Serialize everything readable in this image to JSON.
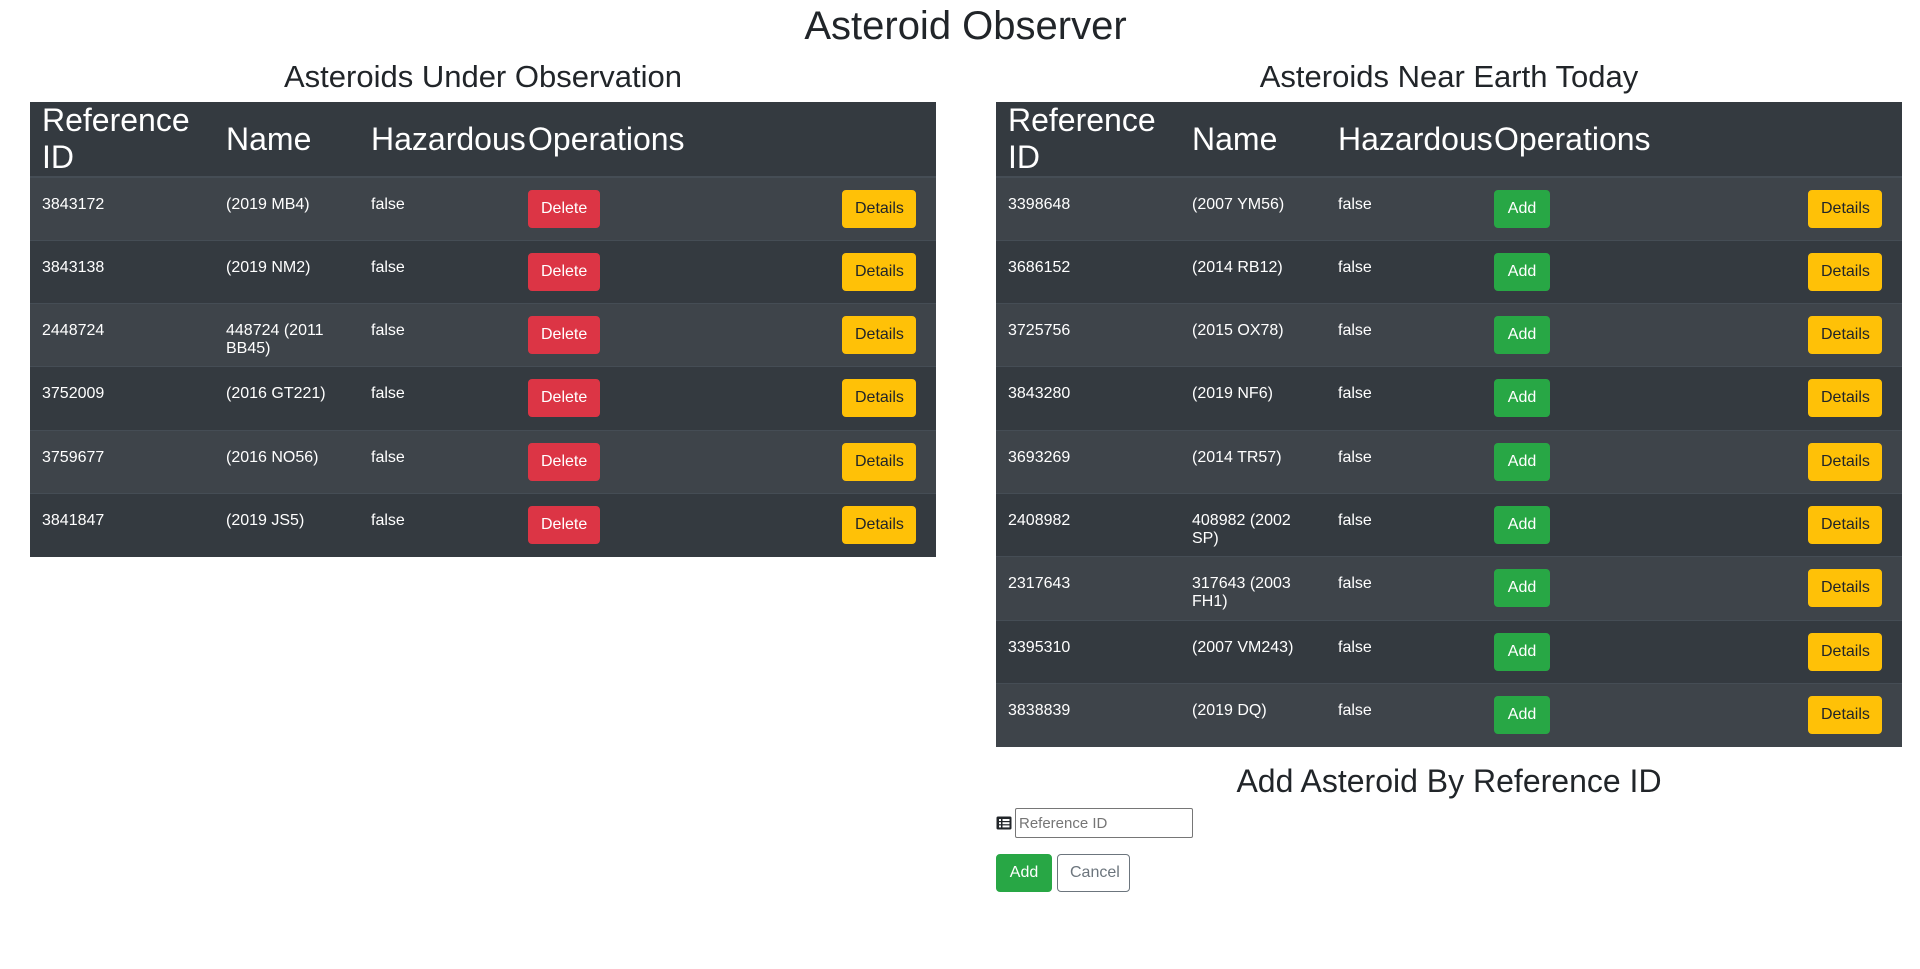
{
  "page": {
    "title": "Asteroid Observer"
  },
  "observation": {
    "title": "Asteroids Under Observation",
    "headers": [
      "Reference ID",
      "Name",
      "Hazardous",
      "Operations"
    ],
    "rows": [
      {
        "ref": "3843172",
        "name": "(2019 MB4)",
        "hazardous": "false",
        "primary": "Delete",
        "details": "Details"
      },
      {
        "ref": "3843138",
        "name": "(2019 NM2)",
        "hazardous": "false",
        "primary": "Delete",
        "details": "Details"
      },
      {
        "ref": "2448724",
        "name": "448724 (2011 BB45)",
        "hazardous": "false",
        "primary": "Delete",
        "details": "Details"
      },
      {
        "ref": "3752009",
        "name": "(2016 GT221)",
        "hazardous": "false",
        "primary": "Delete",
        "details": "Details"
      },
      {
        "ref": "3759677",
        "name": "(2016 NO56)",
        "hazardous": "false",
        "primary": "Delete",
        "details": "Details"
      },
      {
        "ref": "3841847",
        "name": "(2019 JS5)",
        "hazardous": "false",
        "primary": "Delete",
        "details": "Details"
      }
    ]
  },
  "near_earth": {
    "title": "Asteroids Near Earth Today",
    "headers": [
      "Reference ID",
      "Name",
      "Hazardous",
      "Operations"
    ],
    "rows": [
      {
        "ref": "3398648",
        "name": "(2007 YM56)",
        "hazardous": "false",
        "primary": "Add",
        "details": "Details"
      },
      {
        "ref": "3686152",
        "name": "(2014 RB12)",
        "hazardous": "false",
        "primary": "Add",
        "details": "Details"
      },
      {
        "ref": "3725756",
        "name": "(2015 OX78)",
        "hazardous": "false",
        "primary": "Add",
        "details": "Details"
      },
      {
        "ref": "3843280",
        "name": "(2019 NF6)",
        "hazardous": "false",
        "primary": "Add",
        "details": "Details"
      },
      {
        "ref": "3693269",
        "name": "(2014 TR57)",
        "hazardous": "false",
        "primary": "Add",
        "details": "Details"
      },
      {
        "ref": "2408982",
        "name": "408982 (2002 SP)",
        "hazardous": "false",
        "primary": "Add",
        "details": "Details"
      },
      {
        "ref": "2317643",
        "name": "317643 (2003 FH1)",
        "hazardous": "false",
        "primary": "Add",
        "details": "Details"
      },
      {
        "ref": "3395310",
        "name": "(2007 VM243)",
        "hazardous": "false",
        "primary": "Add",
        "details": "Details"
      },
      {
        "ref": "3838839",
        "name": "(2019 DQ)",
        "hazardous": "false",
        "primary": "Add",
        "details": "Details"
      }
    ]
  },
  "add_form": {
    "title": "Add Asteroid By Reference ID",
    "icon": "list-icon",
    "input_value": "",
    "input_placeholder": "Reference ID",
    "add_label": "Add",
    "cancel_label": "Cancel"
  },
  "colors": {
    "table_bg": "#343a40",
    "table_stripe": "#3e444a",
    "danger": "#dc3545",
    "success": "#28a745",
    "warning": "#ffc107"
  }
}
